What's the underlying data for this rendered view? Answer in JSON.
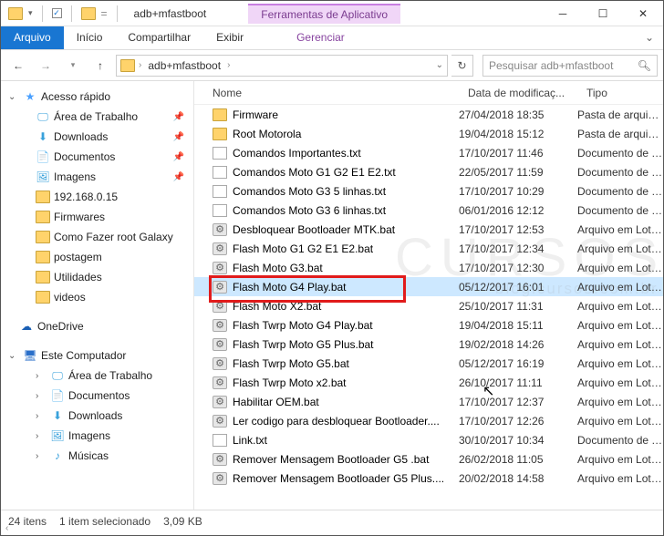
{
  "window": {
    "title": "adb+mfastboot",
    "contextual_tab": "Ferramentas de Aplicativo"
  },
  "ribbon": {
    "arquivo": "Arquivo",
    "inicio": "Início",
    "compartilhar": "Compartilhar",
    "exibir": "Exibir",
    "gerenciar": "Gerenciar"
  },
  "address": {
    "crumb": "adb+mfastboot",
    "search_placeholder": "Pesquisar adb+mfastboot"
  },
  "columns": {
    "name": "Nome",
    "date": "Data de modificaç...",
    "type": "Tipo"
  },
  "sidebar": {
    "quick": "Acesso rápido",
    "quick_items": [
      {
        "label": "Área de Trabalho",
        "icon": "desk"
      },
      {
        "label": "Downloads",
        "icon": "dl"
      },
      {
        "label": "Documentos",
        "icon": "doc"
      },
      {
        "label": "Imagens",
        "icon": "img"
      },
      {
        "label": "192.168.0.15",
        "icon": "folder"
      },
      {
        "label": "Firmwares",
        "icon": "folder"
      },
      {
        "label": "Como Fazer root Galaxy",
        "icon": "folder"
      },
      {
        "label": "postagem",
        "icon": "folder"
      },
      {
        "label": "Utilidades",
        "icon": "folder"
      },
      {
        "label": "videos",
        "icon": "folder"
      }
    ],
    "onedrive": "OneDrive",
    "thispc": "Este Computador",
    "pc_items": [
      {
        "label": "Área de Trabalho",
        "icon": "desk"
      },
      {
        "label": "Documentos",
        "icon": "doc"
      },
      {
        "label": "Downloads",
        "icon": "dl"
      },
      {
        "label": "Imagens",
        "icon": "img"
      },
      {
        "label": "Músicas",
        "icon": "mus"
      }
    ]
  },
  "files": [
    {
      "name": "Firmware",
      "date": "27/04/2018 18:35",
      "type": "Pasta de arquivos",
      "icon": "folder"
    },
    {
      "name": "Root Motorola",
      "date": "19/04/2018 15:12",
      "type": "Pasta de arquivos",
      "icon": "folder"
    },
    {
      "name": "Comandos Importantes.txt",
      "date": "17/10/2017 11:46",
      "type": "Documento de Te...",
      "icon": "txt"
    },
    {
      "name": "Comandos Moto G1 G2 E1 E2.txt",
      "date": "22/05/2017 11:59",
      "type": "Documento de Te...",
      "icon": "txt"
    },
    {
      "name": "Comandos Moto G3 5 linhas.txt",
      "date": "17/10/2017 10:29",
      "type": "Documento de Te...",
      "icon": "txt"
    },
    {
      "name": "Comandos Moto G3 6  linhas.txt",
      "date": "06/01/2016 12:12",
      "type": "Documento de Te...",
      "icon": "txt"
    },
    {
      "name": "Desbloquear Bootloader MTK.bat",
      "date": "17/10/2017 12:53",
      "type": "Arquivo em Lotes ...",
      "icon": "bat"
    },
    {
      "name": "Flash Moto G1 G2 E1 E2.bat",
      "date": "17/10/2017 12:34",
      "type": "Arquivo em Lotes ...",
      "icon": "bat"
    },
    {
      "name": "Flash Moto G3.bat",
      "date": "17/10/2017 12:30",
      "type": "Arquivo em Lotes ...",
      "icon": "bat"
    },
    {
      "name": "Flash Moto G4 Play.bat",
      "date": "05/12/2017 16:01",
      "type": "Arquivo em Lotes ...",
      "icon": "bat",
      "selected": true
    },
    {
      "name": "Flash Moto X2.bat",
      "date": "25/10/2017 11:31",
      "type": "Arquivo em Lotes ...",
      "icon": "bat"
    },
    {
      "name": "Flash Twrp Moto G4 Play.bat",
      "date": "19/04/2018 15:11",
      "type": "Arquivo em Lotes ...",
      "icon": "bat"
    },
    {
      "name": "Flash Twrp Moto G5 Plus.bat",
      "date": "19/02/2018 14:26",
      "type": "Arquivo em Lotes ...",
      "icon": "bat"
    },
    {
      "name": "Flash Twrp Moto G5.bat",
      "date": "05/12/2017 16:19",
      "type": "Arquivo em Lotes ...",
      "icon": "bat"
    },
    {
      "name": "Flash Twrp Moto x2.bat",
      "date": "26/10/2017 11:11",
      "type": "Arquivo em Lotes ...",
      "icon": "bat"
    },
    {
      "name": "Habilitar OEM.bat",
      "date": "17/10/2017 12:37",
      "type": "Arquivo em Lotes ...",
      "icon": "bat"
    },
    {
      "name": "Ler codigo para desbloquear Bootloader....",
      "date": "17/10/2017 12:26",
      "type": "Arquivo em Lotes ...",
      "icon": "bat"
    },
    {
      "name": "Link.txt",
      "date": "30/10/2017 10:34",
      "type": "Documento de Te...",
      "icon": "txt"
    },
    {
      "name": "Remover Mensagem Bootloader G5 .bat",
      "date": "26/02/2018 11:05",
      "type": "Arquivo em Lotes ...",
      "icon": "bat"
    },
    {
      "name": "Remover Mensagem Bootloader G5 Plus....",
      "date": "20/02/2018 14:58",
      "type": "Arquivo em Lotes ...",
      "icon": "bat"
    }
  ],
  "status": {
    "count": "24 itens",
    "selection": "1 item selecionado",
    "size": "3,09 KB"
  }
}
